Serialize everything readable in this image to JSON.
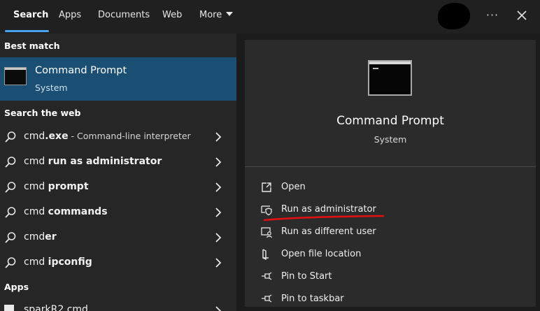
{
  "tabs": [
    {
      "label": "Search",
      "active": true
    },
    {
      "label": "Apps"
    },
    {
      "label": "Documents"
    },
    {
      "label": "Web"
    },
    {
      "label": "More"
    }
  ],
  "header": {
    "more_icon": "ellipsis-icon",
    "close_icon": "close-icon"
  },
  "best_match": {
    "heading": "Best match",
    "title": "Command Prompt",
    "subtitle": "System"
  },
  "web": {
    "heading": "Search the web",
    "items": [
      {
        "prefix": "cmd",
        "bold": ".exe",
        "desc": " - Command-line interpreter"
      },
      {
        "prefix": "cmd ",
        "bold": "run as administrator",
        "desc": ""
      },
      {
        "prefix": "cmd ",
        "bold": "prompt",
        "desc": ""
      },
      {
        "prefix": "cmd ",
        "bold": "commands",
        "desc": ""
      },
      {
        "prefix": "cmd",
        "bold": "er",
        "desc": ""
      },
      {
        "prefix": "cmd ",
        "bold": "ipconfig",
        "desc": ""
      }
    ]
  },
  "apps": {
    "heading": "Apps",
    "items": [
      {
        "label": "sparkR2.cmd"
      }
    ]
  },
  "preview": {
    "title": "Command Prompt",
    "subtitle": "System",
    "actions": [
      {
        "label": "Open",
        "icon": "open-icon"
      },
      {
        "label": "Run as administrator",
        "icon": "shield-icon"
      },
      {
        "label": "Run as different user",
        "icon": "user-icon"
      },
      {
        "label": "Open file location",
        "icon": "folder-icon"
      },
      {
        "label": "Pin to Start",
        "icon": "pin-icon"
      },
      {
        "label": "Pin to taskbar",
        "icon": "pin-icon"
      }
    ]
  },
  "colors": {
    "accent": "#4aa3f0",
    "selection": "#1a4e72",
    "annotation": "#e01010"
  }
}
